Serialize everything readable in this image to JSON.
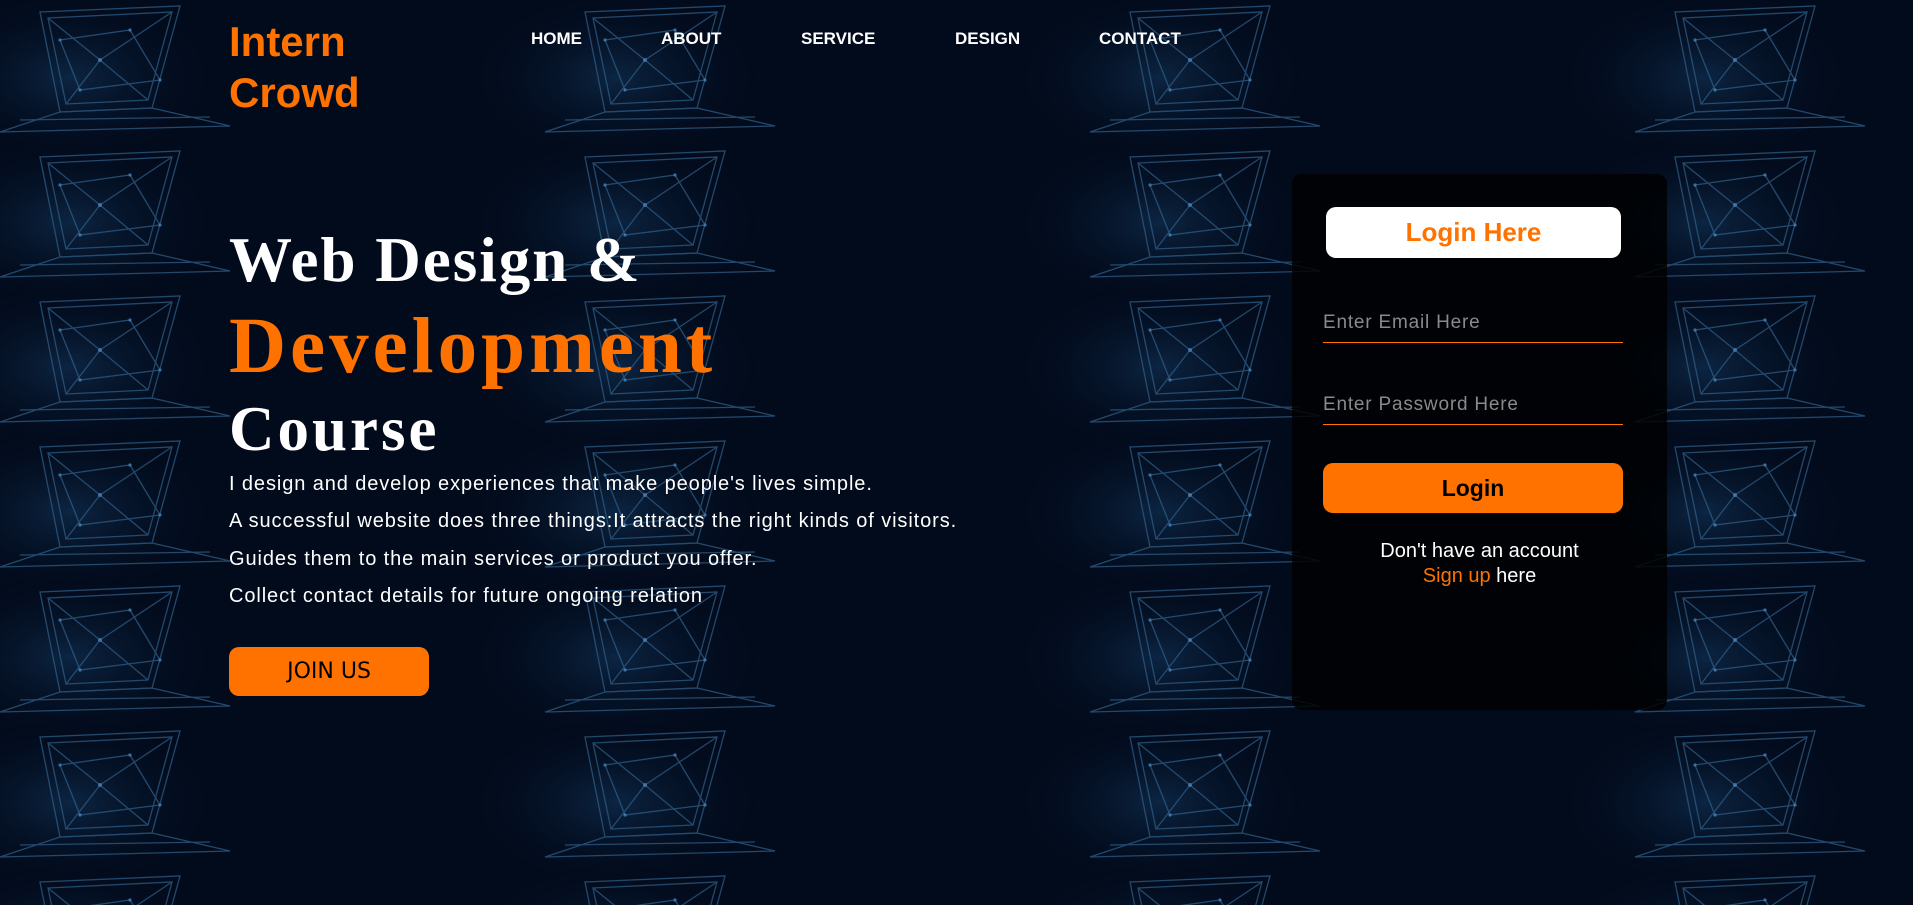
{
  "brand": {
    "line1": "Intern",
    "line2": "Crowd"
  },
  "nav": [
    "HOME",
    "ABOUT",
    "SERVICE",
    "DESIGN",
    "CONTACT"
  ],
  "hero": {
    "line1": "Web Design &",
    "line2": "Development",
    "line3": "Course",
    "paragraphs": [
      "I design and develop experiences that make people's lives simple.",
      "A successful website does three things:It attracts the right kinds of visitors.",
      "Guides them to the main services or product you offer.",
      "Collect contact details for future ongoing relation"
    ],
    "cta_label": "JOIN US"
  },
  "login": {
    "title": "Login Here",
    "email_placeholder": "Enter Email Here",
    "password_placeholder": "Enter Password Here",
    "button_label": "Login",
    "no_account_text": "Don't have an account",
    "signup_link": "Sign up",
    "signup_suffix": " here"
  },
  "colors": {
    "accent": "#ff7200",
    "background": "#020b1c",
    "card": "#000000"
  },
  "background_icon": "laptop-wireframe-icon"
}
